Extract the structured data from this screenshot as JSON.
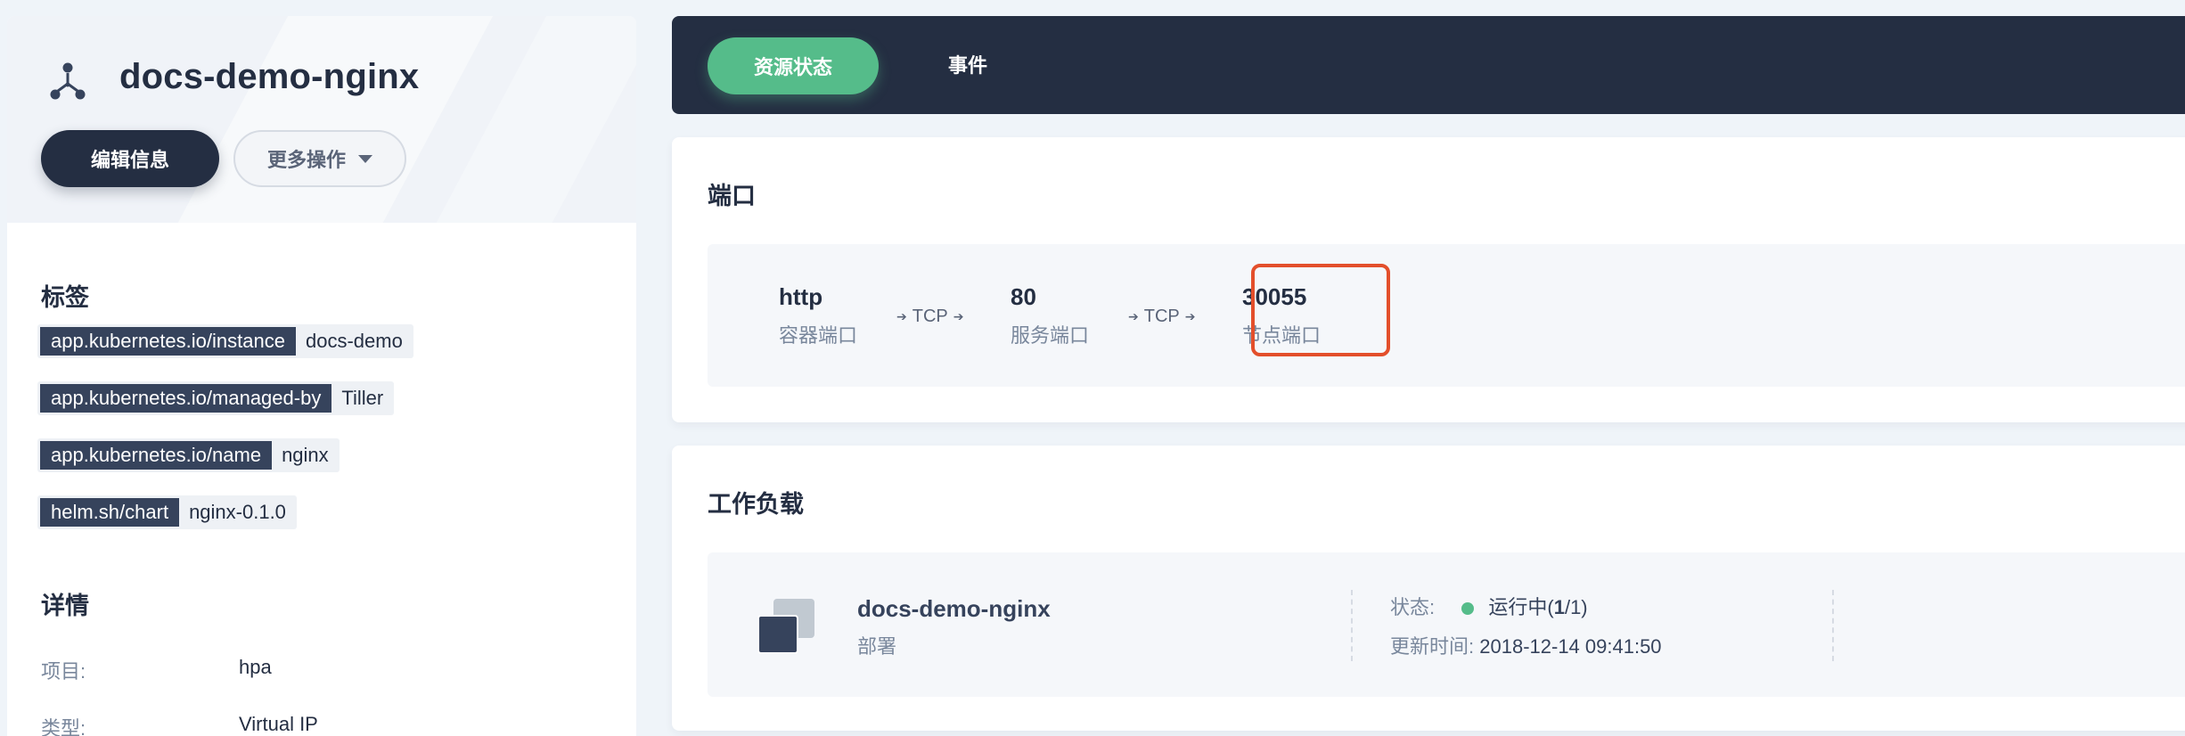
{
  "service": {
    "name": "docs-demo-nginx",
    "icon": "service-topology-icon",
    "edit_label": "编辑信息",
    "more_label": "更多操作"
  },
  "labels_section": {
    "title": "标签",
    "tags": [
      {
        "key": "app.kubernetes.io/instance",
        "value": "docs-demo"
      },
      {
        "key": "app.kubernetes.io/managed-by",
        "value": "Tiller"
      },
      {
        "key": "app.kubernetes.io/name",
        "value": "nginx"
      },
      {
        "key": "helm.sh/chart",
        "value": "nginx-0.1.0"
      }
    ]
  },
  "details_section": {
    "title": "详情",
    "rows": [
      {
        "label": "项目:",
        "value": "hpa"
      },
      {
        "label": "类型:",
        "value": "Virtual IP"
      }
    ]
  },
  "tabs": [
    {
      "label": "资源状态",
      "active": true
    },
    {
      "label": "事件",
      "active": false
    }
  ],
  "ports": {
    "title": "端口",
    "container_port": {
      "value": "http",
      "label": "容器端口"
    },
    "arrow1": "TCP",
    "service_port": {
      "value": "80",
      "label": "服务端口"
    },
    "arrow2": "TCP",
    "node_port": {
      "value": "30055",
      "label": "节点端口"
    }
  },
  "workloads": {
    "title": "工作负载",
    "item": {
      "name": "docs-demo-nginx",
      "type": "部署",
      "status_label": "状态:",
      "status_value_pre": "运行中(",
      "status_value_num": "1",
      "status_value_post": "/1)",
      "updated_label": "更新时间:",
      "updated_value": "2018-12-14 09:41:50"
    }
  },
  "colors": {
    "primary_dark": "#242e42",
    "accent_green": "#55bc8a",
    "highlight_red": "#e34f2b",
    "background": "#eff4f9"
  }
}
